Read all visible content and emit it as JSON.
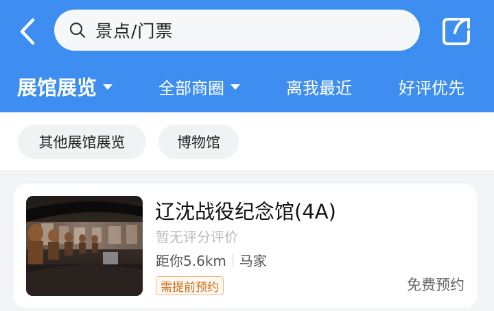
{
  "header": {
    "search": {
      "value": "景点/门票"
    }
  },
  "filters": [
    {
      "label": "展馆展览",
      "active": true,
      "dropdown": true
    },
    {
      "label": "全部商圈",
      "active": false,
      "dropdown": true
    },
    {
      "label": "离我最近",
      "active": false,
      "dropdown": false
    },
    {
      "label": "好评优先",
      "active": false,
      "dropdown": false
    }
  ],
  "chips": [
    {
      "label": "其他展馆展览"
    },
    {
      "label": "博物馆"
    }
  ],
  "results": [
    {
      "title": "辽沈战役纪念馆(4A)",
      "rating_text": "暂无评分评价",
      "distance": "距你5.6km",
      "area": "马家",
      "tag": "需提前预约",
      "price": "免费预约"
    }
  ],
  "colors": {
    "header_bg": "#3d8ef0",
    "tag": "#c96a1a"
  },
  "icons": {
    "back": "chevron-left-icon",
    "search": "search-icon",
    "share": "share-icon"
  }
}
